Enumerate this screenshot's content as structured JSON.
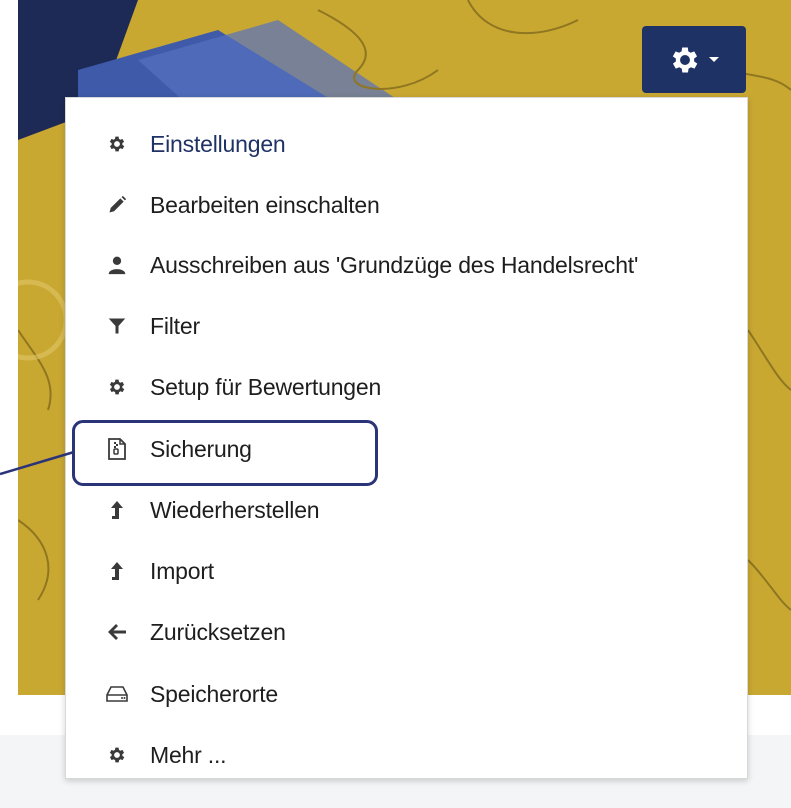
{
  "header": {
    "settings_button": {
      "icon": "gear-icon",
      "caret": "caret-down-icon"
    }
  },
  "menu": {
    "items": [
      {
        "label": "Einstellungen",
        "icon": "gear-icon",
        "active": true
      },
      {
        "label": "Bearbeiten einschalten",
        "icon": "pencil-icon"
      },
      {
        "label": "Ausschreiben aus 'Grundzüge des Handelsrecht'",
        "icon": "user-icon"
      },
      {
        "label": "Filter",
        "icon": "filter-icon"
      },
      {
        "label": "Setup für Bewertungen",
        "icon": "gear-icon"
      },
      {
        "label": "Sicherung",
        "icon": "file-archive-icon",
        "highlighted": true
      },
      {
        "label": "Wiederherstellen",
        "icon": "level-up-icon"
      },
      {
        "label": "Import",
        "icon": "level-up-icon"
      },
      {
        "label": "Zurücksetzen",
        "icon": "arrow-left-icon"
      },
      {
        "label": "Speicherorte",
        "icon": "hdd-icon"
      },
      {
        "label": "Mehr ...",
        "icon": "gear-icon"
      }
    ]
  },
  "colors": {
    "header_bg": "#c9a832",
    "button_bg": "#1f3266",
    "active_text": "#1f3266",
    "highlight_border": "#2b3478"
  }
}
